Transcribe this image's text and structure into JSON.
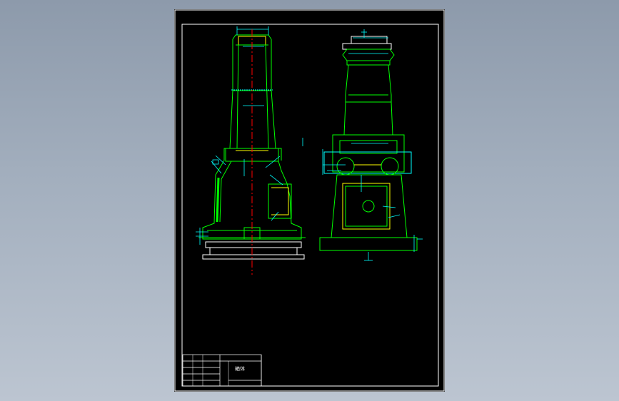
{
  "viewer": {
    "background_top": "#8d9aab",
    "background_bottom": "#bcc5d1"
  },
  "drawing": {
    "paper_color": "#000000",
    "frame_color": "#ffffff",
    "outline_color": "#00ff00",
    "dimension_color": "#00ffff",
    "centerline_color": "#ff0000",
    "hidden_color": "#ffff00",
    "title_block": {
      "title": "箱体"
    }
  }
}
